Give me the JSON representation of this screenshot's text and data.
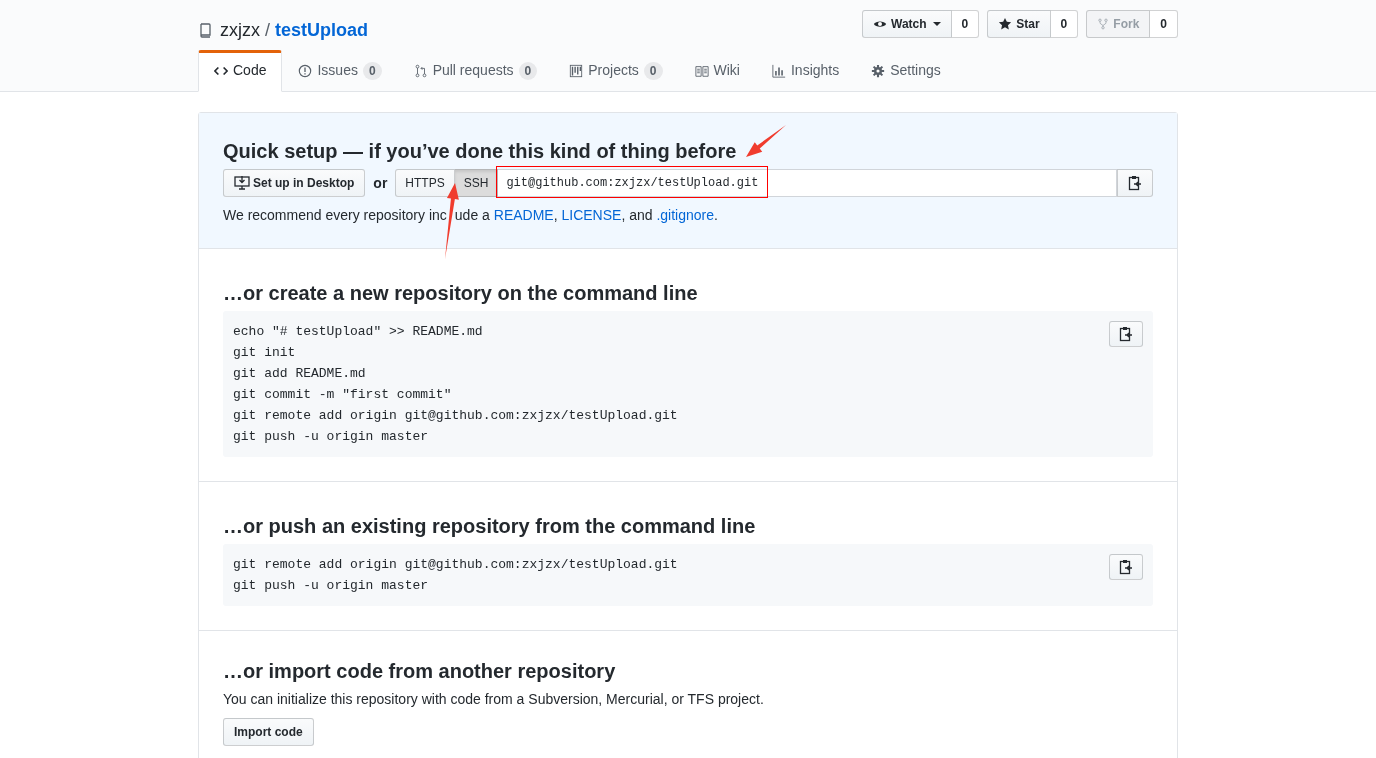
{
  "repo": {
    "owner": "zxjzx",
    "separator": "/",
    "name": "testUpload"
  },
  "actions": [
    {
      "kind": "watch",
      "label": "Watch",
      "count": "0",
      "disabled": false,
      "dropdown": true
    },
    {
      "kind": "star",
      "label": "Star",
      "count": "0",
      "disabled": false,
      "dropdown": false
    },
    {
      "kind": "fork",
      "label": "Fork",
      "count": "0",
      "disabled": true,
      "dropdown": false
    }
  ],
  "tabs": [
    {
      "kind": "code",
      "label": "Code",
      "selected": true
    },
    {
      "kind": "issues",
      "label": "Issues",
      "counter": "0",
      "selected": false
    },
    {
      "kind": "pulls",
      "label": "Pull requests",
      "counter": "0",
      "selected": false
    },
    {
      "kind": "projects",
      "label": "Projects",
      "counter": "0",
      "selected": false
    },
    {
      "kind": "wiki",
      "label": "Wiki",
      "selected": false
    },
    {
      "kind": "insights",
      "label": "Insights",
      "selected": false
    },
    {
      "kind": "settings",
      "label": "Settings",
      "selected": false
    }
  ],
  "quick_setup": {
    "title": "Quick setup — if you’ve done this kind of thing before",
    "desktop_button": "Set up in Desktop",
    "or": "or",
    "protocols": [
      {
        "label": "HTTPS",
        "selected": false
      },
      {
        "label": "SSH",
        "selected": true
      }
    ],
    "url": "git@github.com:zxjzx/testUpload.git",
    "recommend": [
      {
        "kind": "text",
        "text": "We recommend every repository inc"
      },
      {
        "kind": "arrow"
      },
      {
        "kind": "text",
        "text": "ude a "
      },
      {
        "kind": "link",
        "text": "README"
      },
      {
        "kind": "text",
        "text": ", "
      },
      {
        "kind": "link",
        "text": "LICENSE"
      },
      {
        "kind": "text",
        "text": ", and "
      },
      {
        "kind": "link",
        "text": ".gitignore"
      },
      {
        "kind": "text",
        "text": "."
      }
    ]
  },
  "sections": [
    {
      "kind": "commands",
      "title": "…or create a new repository on the command line",
      "lines": [
        "echo \"# testUpload\" >> README.md",
        "git init",
        "git add README.md",
        "git commit -m \"first commit\"",
        "git remote add origin git@github.com:zxjzx/testUpload.git",
        "git push -u origin master"
      ]
    },
    {
      "kind": "commands",
      "title": "…or push an existing repository from the command line",
      "lines": [
        "git remote add origin git@github.com:zxjzx/testUpload.git",
        "git push -u origin master"
      ]
    },
    {
      "kind": "import",
      "title": "…or import code from another repository",
      "text": "You can initialize this repository with code from a Subversion, Mercurial, or TFS project.",
      "button": "Import code"
    }
  ]
}
